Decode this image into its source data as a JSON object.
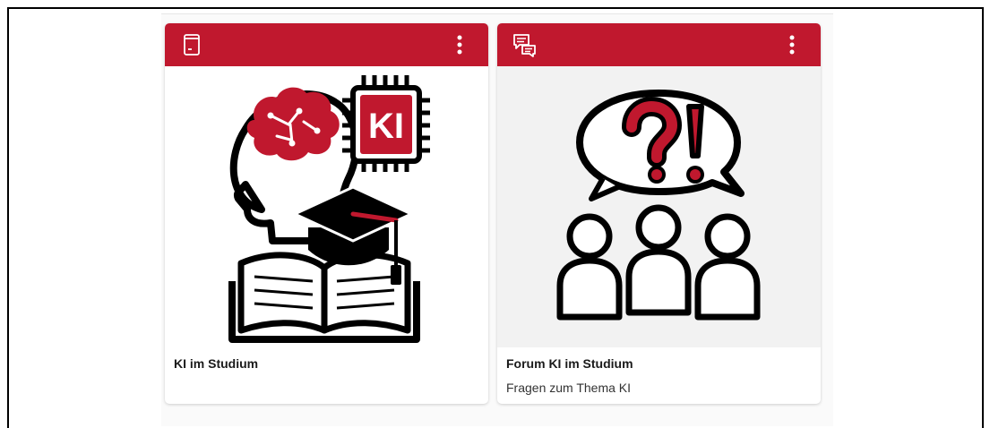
{
  "colors": {
    "brand": "#c0182e",
    "card_background": "#ffffff",
    "image_background_forum": "#f2f2f2"
  },
  "cards": [
    {
      "type_icon": "book-page-icon",
      "menu_icon": "kebab-menu-icon",
      "image": "ai-study-illustration",
      "image_badge": "KI",
      "title": "KI im Studium",
      "description": ""
    },
    {
      "type_icon": "forum-chat-icon",
      "menu_icon": "kebab-menu-icon",
      "image": "forum-questions-illustration",
      "title": "Forum KI im Studium",
      "description": "Fragen zum Thema KI"
    }
  ]
}
